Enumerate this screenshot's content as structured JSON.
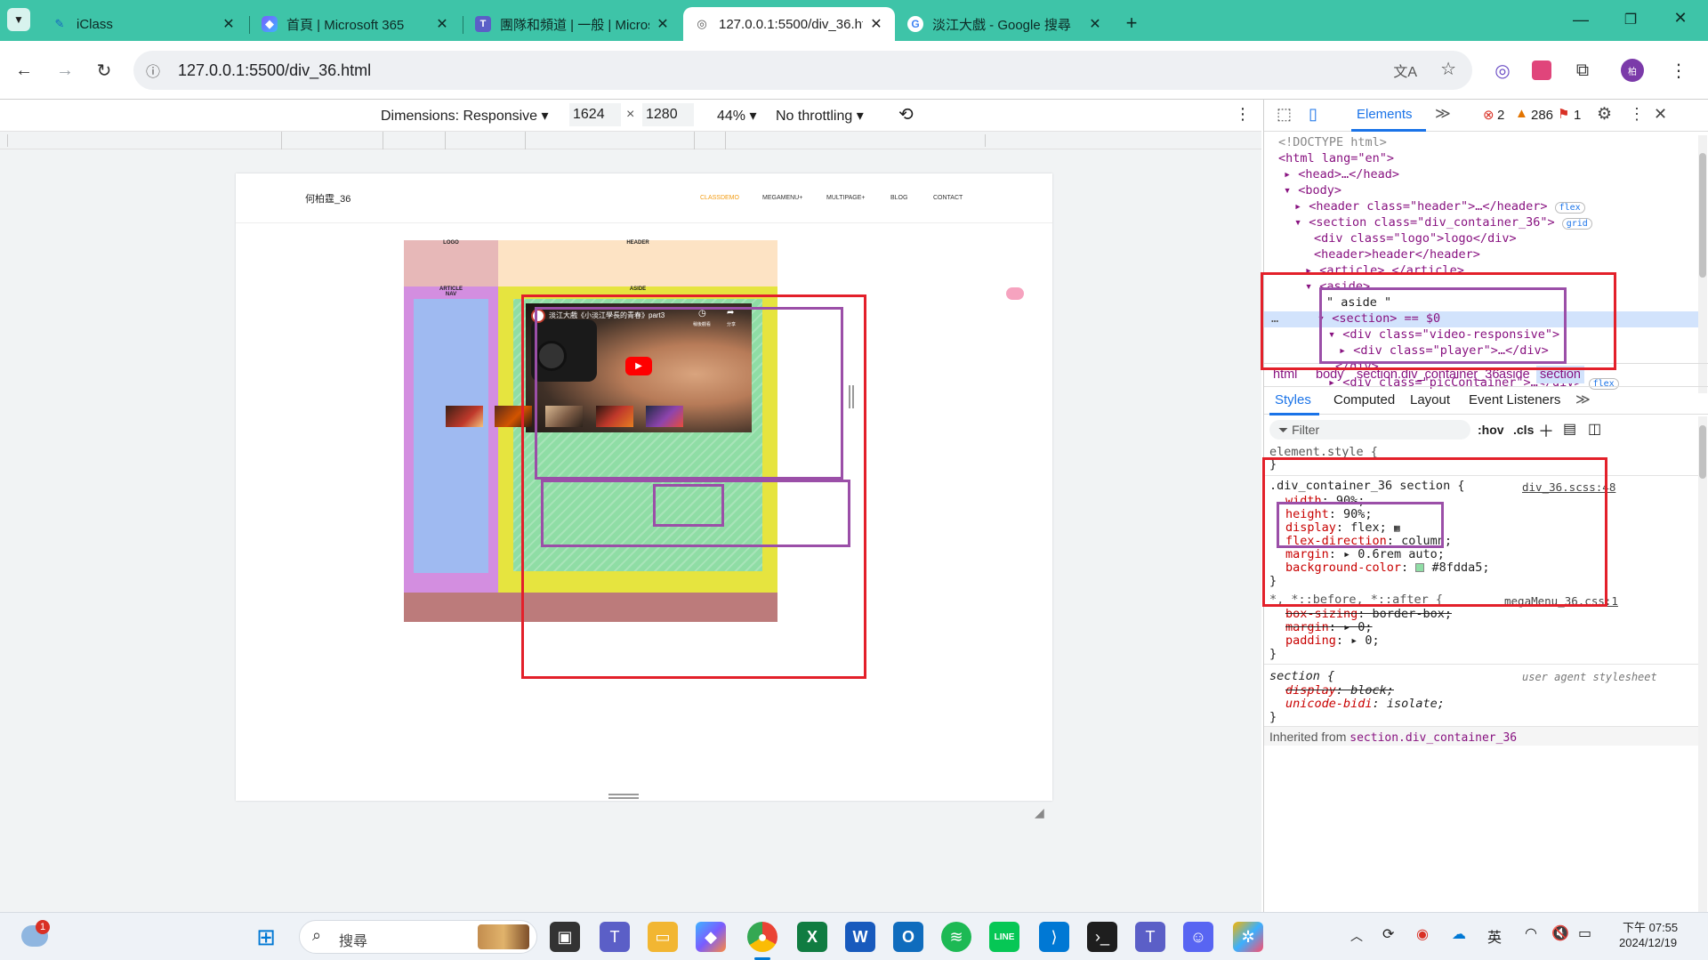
{
  "tabs": [
    {
      "title": "iClass",
      "icon": "iclass-icon"
    },
    {
      "title": "首頁 | Microsoft 365",
      "icon": "copilot-icon"
    },
    {
      "title": "團隊和頻道 | 一般 | Microsoft T",
      "icon": "teams-icon"
    },
    {
      "title": "127.0.0.1:5500/div_36.html",
      "icon": "globe-icon",
      "active": true
    },
    {
      "title": "淡江大戲 - Google 搜尋",
      "icon": "google-icon"
    }
  ],
  "address": {
    "url": "127.0.0.1:5500/div_36.html"
  },
  "device_toolbar": {
    "dimensions_label": "Dimensions: Responsive ▾",
    "width": "1624",
    "times": "×",
    "height": "1280",
    "zoom": "44% ▾",
    "throttle": "No throttling ▾"
  },
  "site": {
    "brand": "何柏霆_36",
    "nav": [
      "CLASSDEMO",
      "MEGAMENU+",
      "MULTIPAGE+",
      "BLOG",
      "CONTACT"
    ],
    "grid": {
      "logo": "LOGO",
      "header": "HEADER",
      "article": "ARTICLE",
      "nav": "NAV",
      "aside": "ASIDE"
    },
    "video_title": "淡江大戲《小淡江學長的青春》part3",
    "video_actions": [
      "稍後觀看",
      "分享"
    ]
  },
  "devtools": {
    "tab_elements": "Elements",
    "errors": "2",
    "warnings": "286",
    "issues": "1",
    "dom": [
      "<!DOCTYPE html>",
      "<html lang=\"en\">",
      "<head>…</head>",
      "<body>",
      "<header class=\"header\">…</header>",
      "<section class=\"div_container_36\">",
      "<div class=\"logo\">logo</div>",
      "<header>header</header>",
      "<article>…</article>",
      "<aside>",
      "\" aside \"",
      "<section> == $0",
      "<div class=\"video-responsive\">",
      "<div class=\"player\">…</div>",
      "</div>",
      "<div class=\"picContainer\">…</div>"
    ],
    "badges": {
      "flex": "flex",
      "grid": "grid"
    },
    "breadcrumbs": [
      "html",
      "body",
      "section.div_container_36",
      "aside",
      "section"
    ],
    "subtabs": [
      "Styles",
      "Computed",
      "Layout",
      "Event Listeners"
    ],
    "filter_placeholder": "Filter",
    "hov": ":hov",
    "cls": ".cls",
    "element_style": "element.style {",
    "rule1_selector": ".div_container_36 section {",
    "rule1_source": "div_36.scss:48",
    "rule1_props": [
      {
        "name": "width",
        "value": "90%;"
      },
      {
        "name": "height",
        "value": "90%;"
      },
      {
        "name": "display",
        "value": "flex;"
      },
      {
        "name": "flex-direction",
        "value": "column;"
      },
      {
        "name": "margin",
        "value": "▸ 0.6rem auto;"
      },
      {
        "name": "background-color",
        "value": "#8fdda5;"
      }
    ],
    "rule2_selector": "*, *::before, *::after {",
    "rule2_source": "megaMenu_36.css:1",
    "rule2_props": [
      {
        "name": "box-sizing",
        "value": "border-box;"
      },
      {
        "name": "margin",
        "value": "▸ 0;"
      },
      {
        "name": "padding",
        "value": "▸ 0;"
      }
    ],
    "rule3_selector": "section {",
    "rule3_source": "user agent stylesheet",
    "rule3_props": [
      {
        "name": "display",
        "value": "block;"
      },
      {
        "name": "unicode-bidi",
        "value": "isolate;"
      }
    ],
    "inherited_label": "Inherited from",
    "inherited_from": "section.div_container_36"
  },
  "taskbar": {
    "search_placeholder": "搜尋",
    "notif_count": "1",
    "ime": "英",
    "time": "下午 07:55",
    "date": "2024/12/19"
  },
  "colors": {
    "tab_strip": "#3ec4a8",
    "logo_bg": "#e7b8b8",
    "header_bg": "#fde3c4",
    "article_bg": "#d38ee0",
    "nav_bg": "#9fbaf1",
    "aside_bg": "#e6e43f",
    "section_bg": "#8fdda5",
    "footer_bg": "#bc7b7b",
    "highlight_red": "#e3202a",
    "highlight_purple": "#9b4fa8"
  }
}
